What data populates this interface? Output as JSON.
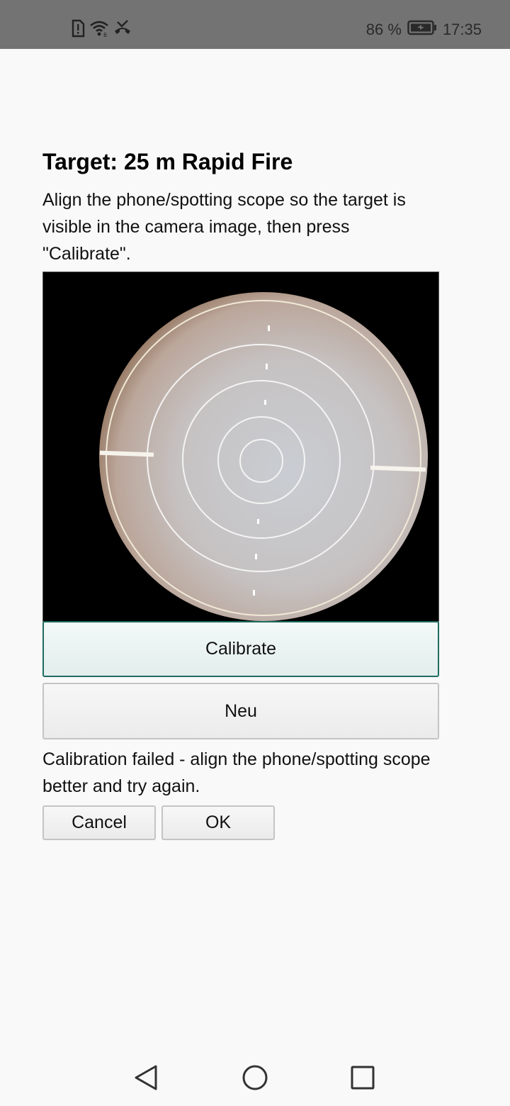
{
  "status_bar": {
    "battery_percent": "86 %",
    "time": "17:35",
    "icons": [
      "sim-alert-icon",
      "wifi-icon",
      "missed-call-icon",
      "battery-charging-icon"
    ]
  },
  "screen": {
    "title": "Target: 25 m Rapid Fire",
    "instructions": "Align the phone/spotting scope so the target is visible in the camera image, then press \"Calibrate\".",
    "calibrate_label": "Calibrate",
    "neu_label": "Neu",
    "message": "Calibration failed - align the phone/spotting scope better and try again.",
    "cancel_label": "Cancel",
    "ok_label": "OK"
  },
  "nav_bar": {
    "icons": [
      "back-icon",
      "home-icon",
      "recents-icon"
    ]
  },
  "colors": {
    "status_bar_bg": "#737373",
    "page_bg": "#f9f9f9",
    "calibrate_border": "#1e6b60"
  }
}
